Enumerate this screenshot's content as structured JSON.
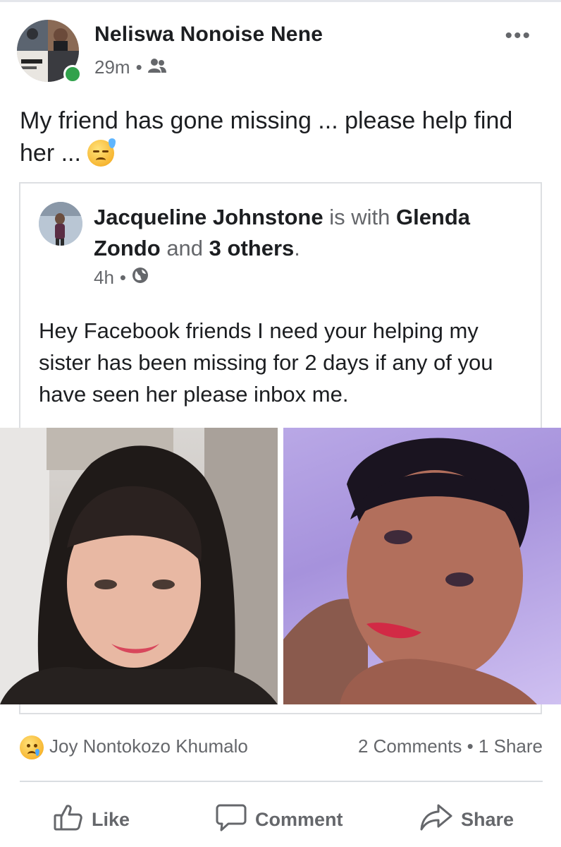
{
  "post": {
    "author": "Neliswa Nonoise Nene",
    "time": "29m",
    "text": "My friend has gone missing ... please help find her ...",
    "more": "•••",
    "audience_icon": "friends-icon",
    "emoji": "sad-sweat-emoji"
  },
  "shared_post": {
    "author": "Jacqueline Johnstone",
    "with_word": "is with",
    "tagged": "Glenda Zondo",
    "and_word": "and",
    "others": "3 others",
    "period": ".",
    "time": "4h",
    "audience_icon": "globe-icon",
    "text": "Hey Facebook friends I need your helping my sister has been missing for 2 days if any of you have seen her please inbox me."
  },
  "engagement": {
    "reaction_icon": "sad-reaction-icon",
    "reactor": "Joy Nontokozo Khumalo",
    "comments": "2 Comments",
    "shares": "1 Share",
    "separator": "•"
  },
  "actions": {
    "like": "Like",
    "comment": "Comment",
    "share": "Share"
  },
  "colors": {
    "online": "#31a24c",
    "secondary_text": "#65676b",
    "border": "#dddfe2"
  }
}
